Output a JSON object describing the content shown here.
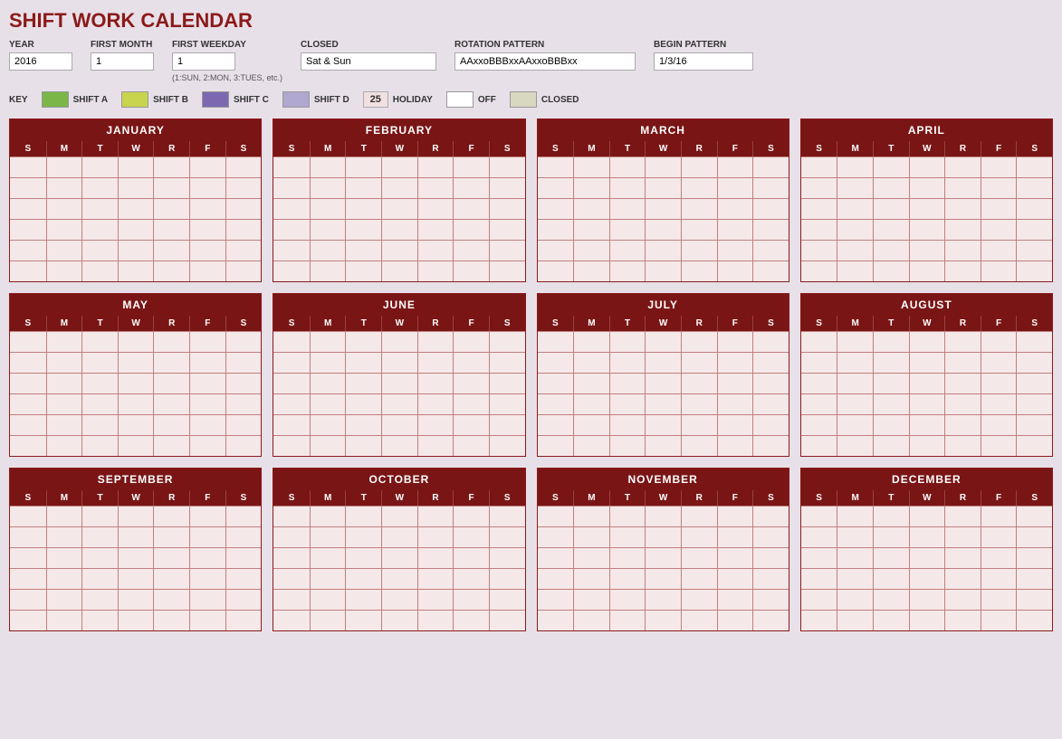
{
  "title": "SHIFT WORK CALENDAR",
  "controls": {
    "year_label": "YEAR",
    "year_value": "2016",
    "first_month_label": "FIRST MONTH",
    "first_month_value": "1",
    "first_weekday_label": "FIRST WEEKDAY",
    "first_weekday_value": "1",
    "first_weekday_hint": "(1:SUN, 2:MON, 3:TUES, etc.)",
    "closed_label": "CLOSED",
    "closed_value": "Sat & Sun",
    "rotation_label": "ROTATION PATTERN",
    "rotation_value": "AAxxoBBBxxAAxxoBBBxx",
    "begin_label": "BEGIN PATTERN",
    "begin_value": "1/3/16"
  },
  "key": {
    "label": "KEY",
    "items": [
      {
        "id": "shift-a",
        "color": "#7ab648",
        "label": "SHIFT A"
      },
      {
        "id": "shift-b",
        "color": "#c8d44e",
        "label": "SHIFT B"
      },
      {
        "id": "shift-c",
        "color": "#7b68b0",
        "label": "SHIFT C"
      },
      {
        "id": "shift-d",
        "color": "#b0a8d0",
        "label": "SHIFT D"
      },
      {
        "id": "holiday",
        "color": "#f0e0e0",
        "label": "HOLIDAY",
        "number": "25"
      },
      {
        "id": "off",
        "color": "#ffffff",
        "label": "OFF"
      },
      {
        "id": "closed",
        "color": "#d8d8c0",
        "label": "CLOSED"
      }
    ]
  },
  "dow_headers": [
    "S",
    "M",
    "T",
    "W",
    "R",
    "F",
    "S"
  ],
  "months": [
    {
      "name": "JANUARY"
    },
    {
      "name": "FEBRUARY"
    },
    {
      "name": "MARCH"
    },
    {
      "name": "APRIL"
    },
    {
      "name": "MAY"
    },
    {
      "name": "JUNE"
    },
    {
      "name": "JULY"
    },
    {
      "name": "AUGUST"
    },
    {
      "name": "SEPTEMBER"
    },
    {
      "name": "OCTOBER"
    },
    {
      "name": "NOVEMBER"
    },
    {
      "name": "DECEMBER"
    }
  ],
  "weeks_per_month": 6,
  "colors": {
    "header_bg": "#7a1515",
    "grid_bg": "#f5e8e8",
    "grid_border": "#c08080",
    "title_color": "#8b1a1a"
  }
}
